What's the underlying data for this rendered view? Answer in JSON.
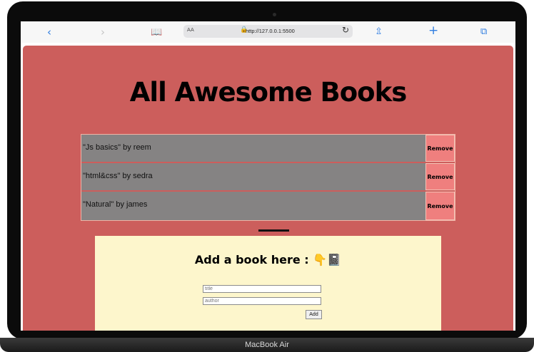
{
  "device": {
    "label": "MacBook Air"
  },
  "browser": {
    "text_size": "AA",
    "url": "http://127.0.0.1:5500",
    "icons": [
      "back-icon",
      "forward-icon",
      "bookmarks-icon",
      "lock-icon",
      "reload-icon",
      "share-icon",
      "new-tab-icon",
      "tabs-icon"
    ]
  },
  "page": {
    "title": "All Awesome Books",
    "books": [
      {
        "text": "\"Js basics\" by reem",
        "remove_label": "Remove"
      },
      {
        "text": "\"html&css\" by sedra",
        "remove_label": "Remove"
      },
      {
        "text": "\"Natural\" by james",
        "remove_label": "Remove"
      }
    ],
    "form": {
      "heading": "Add a book here : 👇📓",
      "title_placeholder": "title",
      "author_placeholder": "author",
      "add_label": "Add"
    }
  },
  "colors": {
    "page_bg": "#cc5e5c",
    "book_row_bg": "#858383",
    "remove_button_bg": "#ef7f7e",
    "form_bg": "#fdf6cc"
  }
}
